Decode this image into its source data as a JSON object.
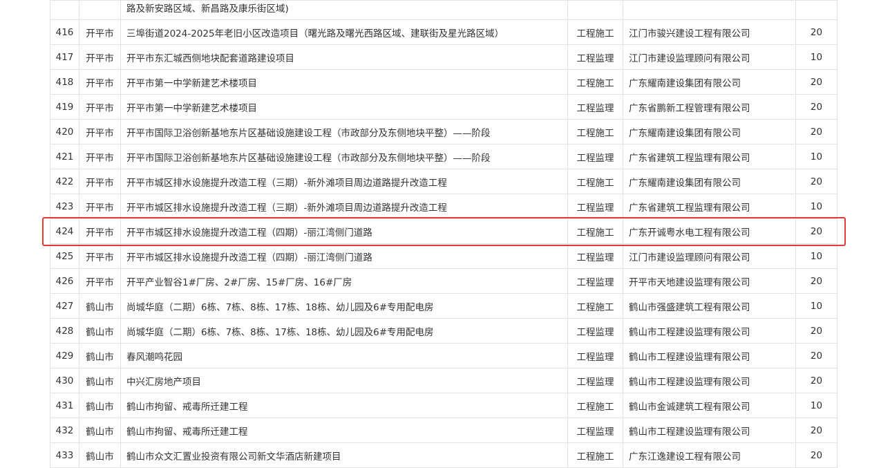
{
  "table": {
    "top_partial_row": {
      "project": "路及新安路区域、新昌路及康乐街区域)"
    },
    "rows": [
      {
        "no": "416",
        "city": "开平市",
        "project": "三埠街道2024-2025年老旧小区改造项目（曙光路及曙光西路区域、建联街及星光路区域）",
        "type": "工程施工",
        "company": "江门市骏兴建设工程有限公司",
        "score": "20"
      },
      {
        "no": "417",
        "city": "开平市",
        "project": "开平市东汇城西侧地块配套道路建设项目",
        "type": "工程监理",
        "company": "江门市建设监理顾问有限公司",
        "score": "10"
      },
      {
        "no": "418",
        "city": "开平市",
        "project": "开平市第一中学新建艺术楼项目",
        "type": "工程施工",
        "company": "广东耀南建设集团有限公司",
        "score": "20"
      },
      {
        "no": "419",
        "city": "开平市",
        "project": "开平市第一中学新建艺术楼项目",
        "type": "工程监理",
        "company": "广东省鹏新工程管理有限公司",
        "score": "20"
      },
      {
        "no": "420",
        "city": "开平市",
        "project": "开平市国际卫浴创新基地东片区基础设施建设工程（市政部分及东侧地块平整）——阶段",
        "type": "工程施工",
        "company": "广东耀南建设集团有限公司",
        "score": "20"
      },
      {
        "no": "421",
        "city": "开平市",
        "project": "开平市国际卫浴创新基地东片区基础设施建设工程（市政部分及东侧地块平整）——阶段",
        "type": "工程监理",
        "company": "广东省建筑工程监理有限公司",
        "score": "10"
      },
      {
        "no": "422",
        "city": "开平市",
        "project": "开平市城区排水设施提升改造工程（三期）-新外滩项目周边道路提升改造工程",
        "type": "工程施工",
        "company": "广东耀南建设集团有限公司",
        "score": "20"
      },
      {
        "no": "423",
        "city": "开平市",
        "project": "开平市城区排水设施提升改造工程（三期）-新外滩项目周边道路提升改造工程",
        "type": "工程监理",
        "company": "广东省建筑工程监理有限公司",
        "score": "10"
      },
      {
        "no": "424",
        "city": "开平市",
        "project": "开平市城区排水设施提升改造工程（四期）-丽江湾侧门道路",
        "type": "工程施工",
        "company": "广东开诚粤水电工程有限公司",
        "score": "20"
      },
      {
        "no": "425",
        "city": "开平市",
        "project": "开平市城区排水设施提升改造工程（四期）-丽江湾侧门道路",
        "type": "工程监理",
        "company": "江门市建设监理顾问有限公司",
        "score": "10"
      },
      {
        "no": "426",
        "city": "开平市",
        "project": "开平产业智谷1#厂房、2#厂房、15#厂房、16#厂房",
        "type": "工程监理",
        "company": "开平市天地建设监理有限公司",
        "score": "20"
      },
      {
        "no": "427",
        "city": "鹤山市",
        "project": "尚城华庭（二期）6栋、7栋、8栋、17栋、18栋、幼儿园及6#专用配电房",
        "type": "工程施工",
        "company": "鹤山市强盛建筑工程有限公司",
        "score": "10"
      },
      {
        "no": "428",
        "city": "鹤山市",
        "project": "尚城华庭（二期）6栋、7栋、8栋、17栋、18栋、幼儿园及6#专用配电房",
        "type": "工程监理",
        "company": "鹤山市工程建设监理有限公司",
        "score": "20"
      },
      {
        "no": "429",
        "city": "鹤山市",
        "project": "春风潮鸣花园",
        "type": "工程监理",
        "company": "鹤山市工程建设监理有限公司",
        "score": "20"
      },
      {
        "no": "430",
        "city": "鹤山市",
        "project": "中兴汇房地产项目",
        "type": "工程监理",
        "company": "鹤山市工程建设监理有限公司",
        "score": "20"
      },
      {
        "no": "431",
        "city": "鹤山市",
        "project": "鹤山市拘留、戒毒所迁建工程",
        "type": "工程施工",
        "company": "鹤山市金诚建筑工程有限公司",
        "score": "10"
      },
      {
        "no": "432",
        "city": "鹤山市",
        "project": "鹤山市拘留、戒毒所迁建工程",
        "type": "工程监理",
        "company": "鹤山市工程建设监理有限公司",
        "score": "20"
      },
      {
        "no": "433",
        "city": "鹤山市",
        "project": "鹤山市众文汇置业投资有限公司新文华酒店新建项目",
        "type": "工程施工",
        "company": "广东江逸建设工程有限公司",
        "score": "20"
      }
    ],
    "highlighted_row_no": "424"
  },
  "colors": {
    "highlight_border": "#e53935",
    "grid_line": "#e2e2e2",
    "text": "#333333"
  }
}
